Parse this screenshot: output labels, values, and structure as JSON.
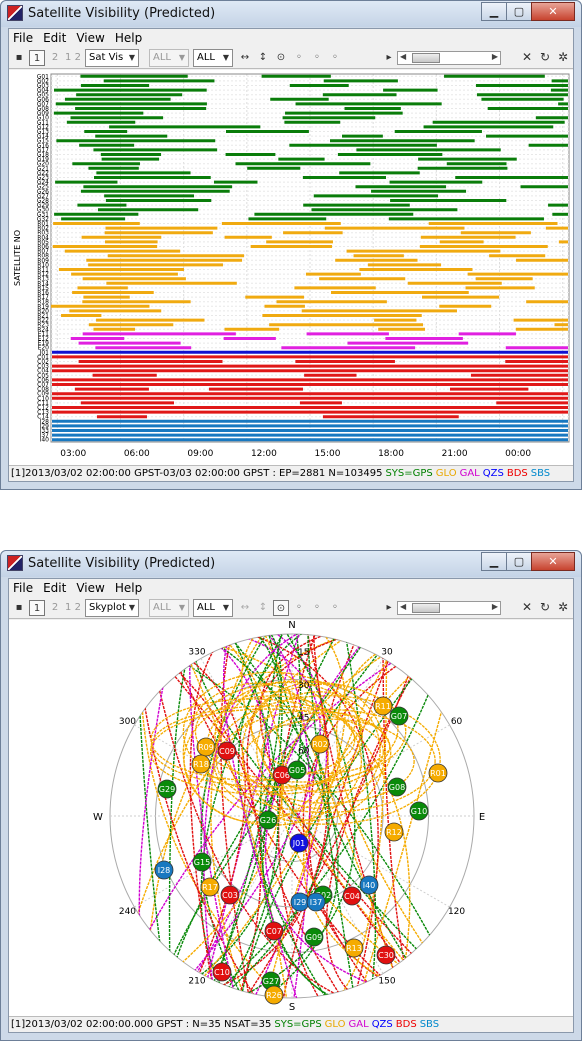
{
  "windows": [
    {
      "id": "w1",
      "app_title": "Satellite Visibility (Predicted)",
      "menu": [
        "File",
        "Edit",
        "View",
        "Help"
      ],
      "toolbar": {
        "plot_type": "Sat Vis",
        "filter1": "ALL",
        "filter2": "ALL",
        "frame_buttons": [
          "1",
          "2",
          "1 2"
        ]
      },
      "status": {
        "prefix": "[1]2013/03/02 02:00:00 GPST-03/03 02:00:00 GPST : EP=2881 N=103495",
        "systems": [
          {
            "label": "SYS=GPS",
            "color": "#008000"
          },
          {
            "label": "GLO",
            "color": "#e8a800"
          },
          {
            "label": "GAL",
            "color": "#d000d0"
          },
          {
            "label": "QZS",
            "color": "#0000ff"
          },
          {
            "label": "BDS",
            "color": "#ee0000"
          },
          {
            "label": "SBS",
            "color": "#0088cc"
          }
        ]
      },
      "yaxis_label": "SATELLITE NO",
      "xaxis_ticks": [
        "03:00",
        "06:00",
        "09:00",
        "12:00",
        "15:00",
        "18:00",
        "21:00",
        "00:00"
      ],
      "satellites": [
        "G01",
        "G02",
        "G03",
        "G04",
        "G05",
        "G06",
        "G07",
        "G08",
        "G09",
        "G10",
        "G11",
        "G12",
        "G13",
        "G14",
        "G15",
        "G16",
        "G17",
        "G18",
        "G19",
        "G20",
        "G21",
        "G22",
        "G23",
        "G24",
        "G25",
        "G26",
        "G27",
        "G28",
        "G29",
        "G30",
        "G31",
        "G32",
        "R01",
        "R02",
        "R03",
        "R04",
        "R05",
        "R06",
        "R07",
        "R08",
        "R09",
        "R10",
        "R11",
        "R12",
        "R13",
        "R14",
        "R15",
        "R16",
        "R17",
        "R18",
        "R19",
        "R20",
        "R21",
        "R22",
        "R23",
        "R24",
        "E11",
        "E12",
        "E19",
        "E20",
        "J01",
        "C01",
        "C02",
        "C03",
        "C04",
        "C05",
        "C06",
        "C07",
        "C08",
        "C09",
        "C10",
        "C11",
        "C12",
        "C13",
        "C14",
        "I28",
        "I29",
        "I33",
        "I37",
        "I40"
      ]
    },
    {
      "id": "w2",
      "app_title": "Satellite Visibility (Predicted)",
      "menu": [
        "File",
        "Edit",
        "View",
        "Help"
      ],
      "toolbar": {
        "plot_type": "Skyplot",
        "filter1": "ALL",
        "filter2": "ALL",
        "frame_buttons": [
          "1",
          "2",
          "1 2"
        ]
      },
      "status": {
        "prefix": "[1]2013/03/02 02:00:00.000 GPST : N=35 NSAT=35",
        "systems": [
          {
            "label": "SYS=GPS",
            "color": "#008000"
          },
          {
            "label": "GLO",
            "color": "#e8a800"
          },
          {
            "label": "GAL",
            "color": "#d000d0"
          },
          {
            "label": "QZS",
            "color": "#0000ff"
          },
          {
            "label": "BDS",
            "color": "#ee0000"
          },
          {
            "label": "SBS",
            "color": "#0088cc"
          }
        ]
      },
      "compass": {
        "N": "N",
        "E": "E",
        "S": "S",
        "W": "W"
      },
      "az_labels": [
        "30",
        "60",
        "120",
        "150",
        "210",
        "240",
        "300",
        "330"
      ],
      "el_labels": [
        "15",
        "30",
        "45",
        "60"
      ],
      "sats": [
        {
          "id": "R11",
          "c": "#f5ab00"
        },
        {
          "id": "G07",
          "c": "#0a8a0a"
        },
        {
          "id": "R02",
          "c": "#f5ab00"
        },
        {
          "id": "C09",
          "c": "#e01010"
        },
        {
          "id": "R09",
          "c": "#f5ab00"
        },
        {
          "id": "R18",
          "c": "#f5ab00"
        },
        {
          "id": "C06",
          "c": "#e01010"
        },
        {
          "id": "G05",
          "c": "#0a8a0a"
        },
        {
          "id": "R01",
          "c": "#f5ab00"
        },
        {
          "id": "G29",
          "c": "#0a8a0a"
        },
        {
          "id": "G08",
          "c": "#0a8a0a"
        },
        {
          "id": "G10",
          "c": "#0a8a0a"
        },
        {
          "id": "G26",
          "c": "#0a8a0a"
        },
        {
          "id": "R12",
          "c": "#f5ab00"
        },
        {
          "id": "J01",
          "c": "#1010e0"
        },
        {
          "id": "I28",
          "c": "#1878c0"
        },
        {
          "id": "G15",
          "c": "#0a8a0a"
        },
        {
          "id": "R17",
          "c": "#f5ab00"
        },
        {
          "id": "C03",
          "c": "#e01010"
        },
        {
          "id": "I40",
          "c": "#1878c0"
        },
        {
          "id": "G02",
          "c": "#0a8a0a"
        },
        {
          "id": "C04",
          "c": "#e01010"
        },
        {
          "id": "I29",
          "c": "#1878c0"
        },
        {
          "id": "I37",
          "c": "#1878c0"
        },
        {
          "id": "C07",
          "c": "#e01010"
        },
        {
          "id": "G09",
          "c": "#0a8a0a"
        },
        {
          "id": "R13",
          "c": "#f5ab00"
        },
        {
          "id": "C30",
          "c": "#e01010"
        },
        {
          "id": "C10",
          "c": "#e01010"
        },
        {
          "id": "G27",
          "c": "#0a8a0a"
        },
        {
          "id": "R26",
          "c": "#f5ab00"
        }
      ]
    }
  ]
}
